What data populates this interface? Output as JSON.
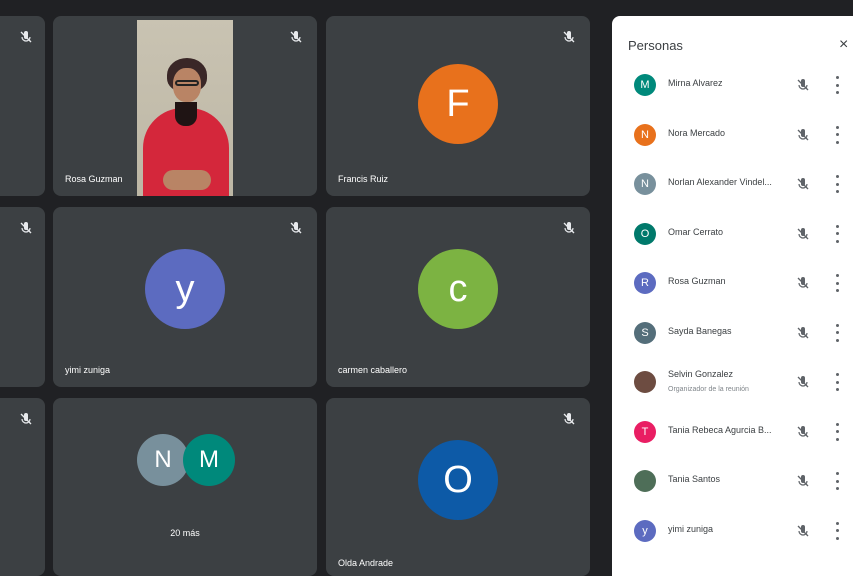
{
  "colors": {
    "tile_bg": "#3c4043",
    "page_bg": "#202124",
    "panel_bg": "#ffffff",
    "avatar_orange": "#e8711c",
    "avatar_purple": "#5c6bc0",
    "avatar_green": "#7cb342",
    "avatar_blue": "#0d5aa7",
    "avatar_teal": "#00897b",
    "avatar_grey": "#78909c"
  },
  "tiles": [
    {
      "name": "Rosa Guzman",
      "type": "video"
    },
    {
      "name": "Francis Ruiz",
      "initial": "F",
      "color": "#e8711c"
    },
    {
      "name": "yimi zuniga",
      "initial": "y",
      "color": "#5c6bc0"
    },
    {
      "name": "carmen caballero",
      "initial": "c",
      "color": "#7cb342"
    },
    {
      "name": "20 más",
      "initials": [
        "N",
        "M"
      ]
    },
    {
      "name": "Olda Andrade",
      "initial": "O",
      "color": "#0d5aa7"
    }
  ],
  "panel": {
    "title": "Personas",
    "close_glyph": "×",
    "people": [
      {
        "initial": "M",
        "name": "Mirna Alvarez",
        "color": "#00897b"
      },
      {
        "initial": "N",
        "name": "Nora Mercado",
        "color": "#e8711c"
      },
      {
        "initial": "N",
        "name": "Norlan Alexander Vindel...",
        "color": "#78909c"
      },
      {
        "initial": "O",
        "name": "Omar Cerrato",
        "color": "#00796b"
      },
      {
        "initial": "R",
        "name": "Rosa Guzman",
        "color": "#5c6bc0"
      },
      {
        "initial": "S",
        "name": "Sayda Banegas",
        "color": "#546e7a"
      },
      {
        "initial": "",
        "name": "Selvin Gonzalez",
        "role": "Organizador de la reunión",
        "color": "#6d4c41"
      },
      {
        "initial": "T",
        "name": "Tania Rebeca Agurcia B...",
        "color": "#e91e63"
      },
      {
        "initial": "",
        "name": "Tania Santos",
        "color": "#4e6e58"
      },
      {
        "initial": "y",
        "name": "yimi zuniga",
        "color": "#5c6bc0"
      }
    ]
  },
  "icons": {
    "mic_off": "mic-off-icon",
    "more": "more-vert-icon",
    "close": "close-icon"
  }
}
